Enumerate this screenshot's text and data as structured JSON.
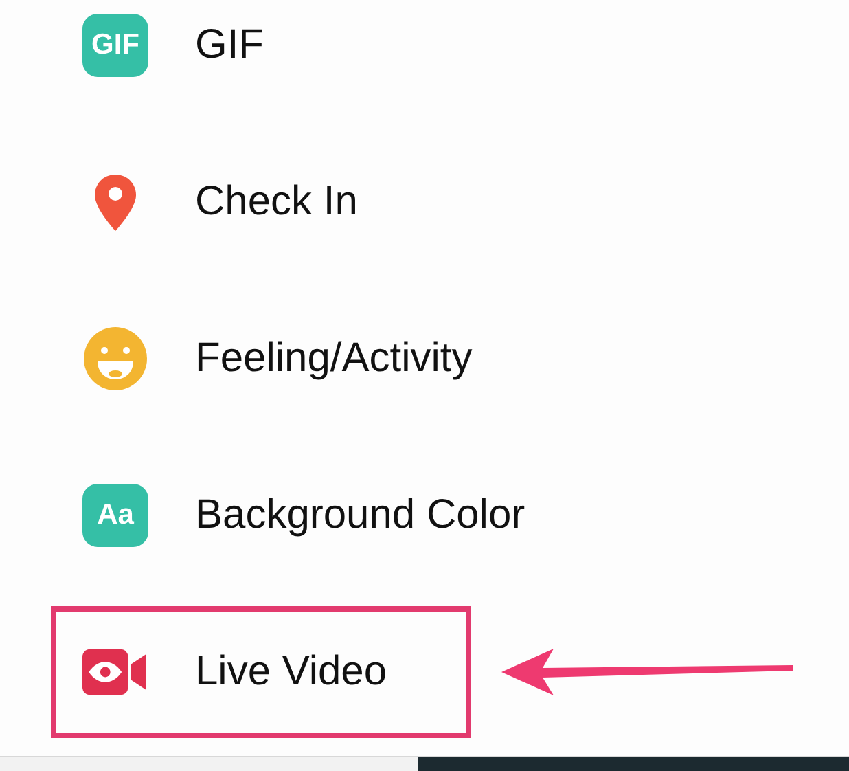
{
  "menu": {
    "items": [
      {
        "kind": "badge",
        "badge_text": "GIF",
        "label": "GIF",
        "highlighted": false
      },
      {
        "kind": "pin",
        "label": "Check In",
        "highlighted": false
      },
      {
        "kind": "smile",
        "label": "Feeling/Activity",
        "highlighted": false
      },
      {
        "kind": "badge",
        "badge_text": "Aa",
        "label": "Background Color",
        "highlighted": false
      },
      {
        "kind": "video",
        "label": "Live Video",
        "highlighted": true
      }
    ]
  },
  "annotation": {
    "arrow": true
  }
}
